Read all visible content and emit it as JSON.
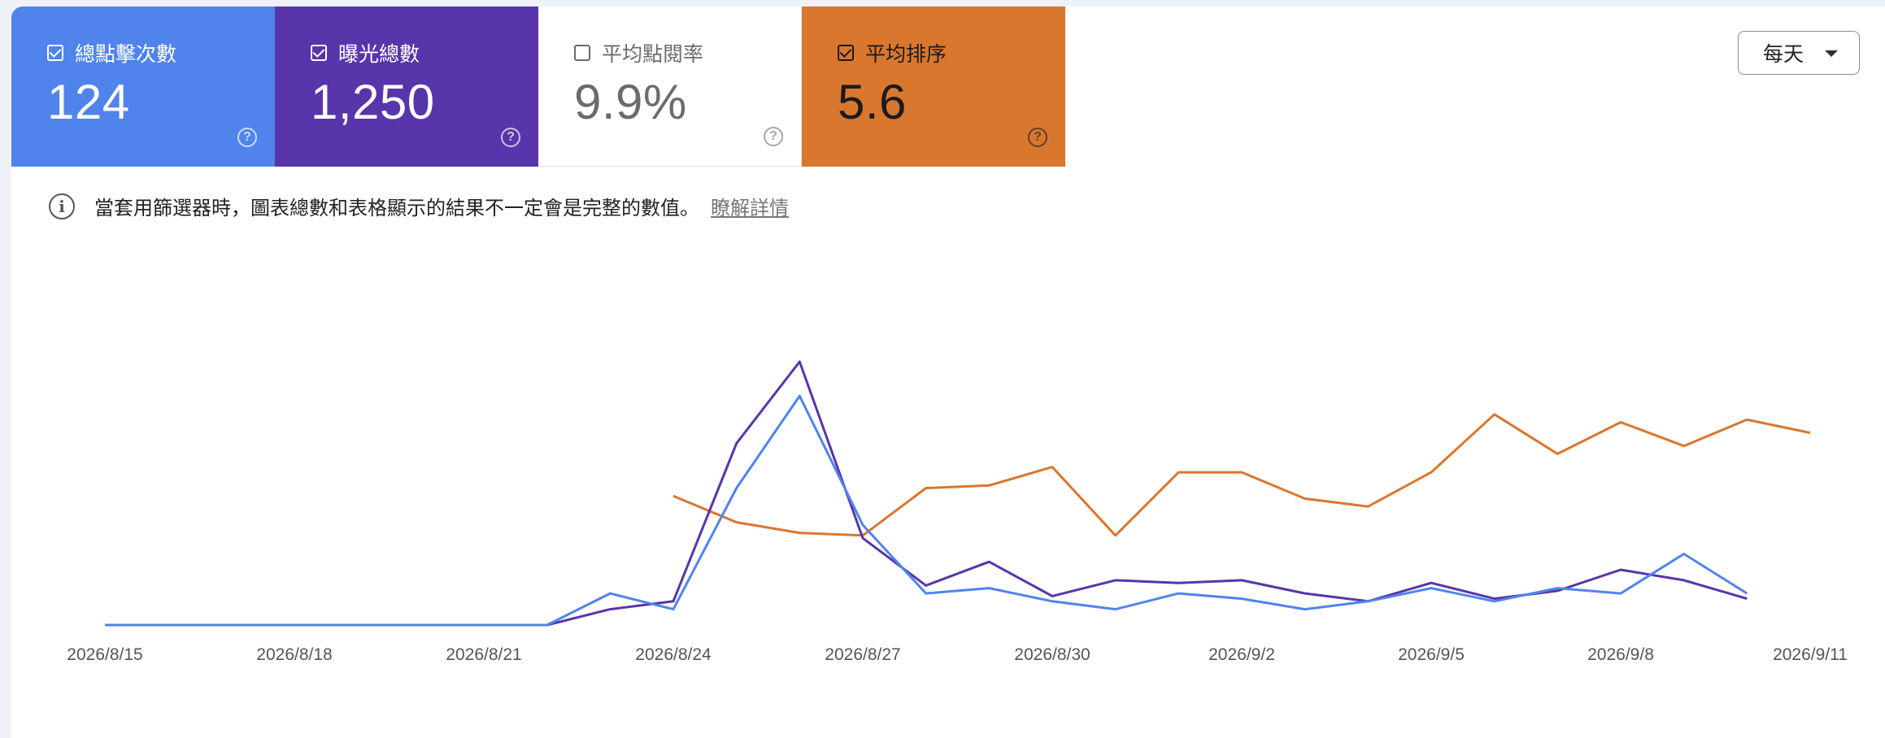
{
  "metrics": {
    "clicks": {
      "label": "總點擊次數",
      "value": "124",
      "checked": true,
      "color": "#5084ec"
    },
    "impressions": {
      "label": "曝光總數",
      "value": "1,250",
      "checked": true,
      "color": "#5835aa"
    },
    "ctr": {
      "label": "平均點閱率",
      "value": "9.9%",
      "checked": false,
      "color": "#ffffff"
    },
    "position": {
      "label": "平均排序",
      "value": "5.6",
      "checked": true,
      "color": "#d9772f"
    }
  },
  "period_dropdown": {
    "selected": "每天"
  },
  "notice": {
    "text": "當套用篩選器時，圖表總數和表格顯示的結果不一定會是完整的數值。",
    "link": "瞭解詳情"
  },
  "chart_data": {
    "type": "line",
    "x": [
      "2026/8/15",
      "2026/8/16",
      "2026/8/17",
      "2026/8/18",
      "2026/8/19",
      "2026/8/20",
      "2026/8/21",
      "2026/8/22",
      "2026/8/23",
      "2026/8/24",
      "2026/8/25",
      "2026/8/26",
      "2026/8/27",
      "2026/8/28",
      "2026/8/29",
      "2026/8/30",
      "2026/8/31",
      "2026/9/1",
      "2026/9/2",
      "2026/9/3",
      "2026/9/4",
      "2026/9/5",
      "2026/9/6",
      "2026/9/7",
      "2026/9/8",
      "2026/9/9",
      "2026/9/10",
      "2026/9/11"
    ],
    "x_tick_labels": [
      "2026/8/15",
      "2026/8/18",
      "2026/8/21",
      "2026/8/24",
      "2026/8/27",
      "2026/8/30",
      "2026/9/2",
      "2026/9/5",
      "2026/9/8",
      "2026/9/11"
    ],
    "series": [
      {
        "color": "#5835aa",
        "values": [
          0,
          0,
          0,
          0,
          0,
          0,
          0,
          0,
          6,
          9,
          69,
          100,
          33,
          15,
          24,
          11,
          17,
          16,
          17,
          12,
          9,
          16,
          10,
          13,
          21,
          17,
          10
        ]
      },
      {
        "color": "#5084ec",
        "values": [
          0,
          0,
          0,
          0,
          0,
          0,
          0,
          0,
          12,
          6,
          52,
          87,
          38,
          12,
          14,
          9,
          6,
          12,
          10,
          6,
          9,
          14,
          9,
          14,
          12,
          27,
          12
        ]
      },
      {
        "color": "#d9772f",
        "values": [
          null,
          null,
          null,
          null,
          null,
          null,
          null,
          null,
          null,
          49,
          39,
          35,
          34,
          52,
          53,
          60,
          34,
          58,
          58,
          48,
          45,
          58,
          80,
          65,
          77,
          68,
          78,
          73
        ]
      }
    ],
    "legend": "none",
    "grid": false
  }
}
